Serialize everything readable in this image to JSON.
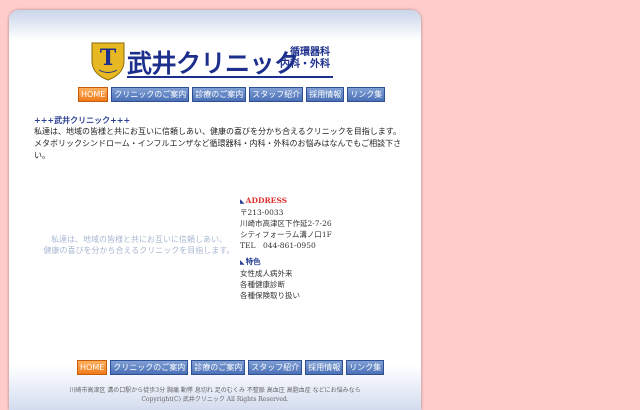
{
  "header": {
    "title": "武井クリニック",
    "subtitle_line1": "循環器科",
    "subtitle_line2": "内科・外科",
    "emblem_letter": "T"
  },
  "nav": {
    "items": [
      {
        "label": "HOME"
      },
      {
        "label": "クリニックのご案内"
      },
      {
        "label": "診療のご案内"
      },
      {
        "label": "スタッフ紹介"
      },
      {
        "label": "採用情報"
      },
      {
        "label": "リンク集"
      }
    ]
  },
  "intro": {
    "heading": "+++武井クリニック+++",
    "line1": "私達は、地域の皆様と共にお互いに信頼しあい、健康の喜びを分かち合えるクリニックを目指します。",
    "line2": "メタボリックシンドローム・インフルエンザなど循環器科・内科・外科のお悩みはなんでもご相談下さい。"
  },
  "tagline": {
    "line1": "私達は、地域の皆様と共にお互いに信頼しあい、",
    "line2": "健康の喜びを分かち合えるクリニックを目指します。"
  },
  "address": {
    "heading": "ADDRESS",
    "postal": "〒213-0033",
    "street": "川崎市高津区下作延2-7-26",
    "building": "シティフォーラム溝ノ口1F",
    "tel": "TEL　044-861-0950"
  },
  "features": {
    "heading": "特色",
    "items": [
      "女性成人病外来",
      "各種健康診断",
      "各種保険取り扱い"
    ]
  },
  "footer": {
    "keywords": "川崎市高津区 溝の口駅から徒歩3分 胸痛 動悸 息切れ 足のむくみ 不整脈 高血圧 高脂血症 などにお悩みなら",
    "copyright": "Copyright(C) 武井クリニック All Rights Reserved."
  },
  "colors": {
    "background": "#ffcccc",
    "brand_navy": "#1c2f8c",
    "nav_blue": "#4b70b6",
    "nav_active_orange": "#f07a1a",
    "address_red": "#e03030"
  }
}
